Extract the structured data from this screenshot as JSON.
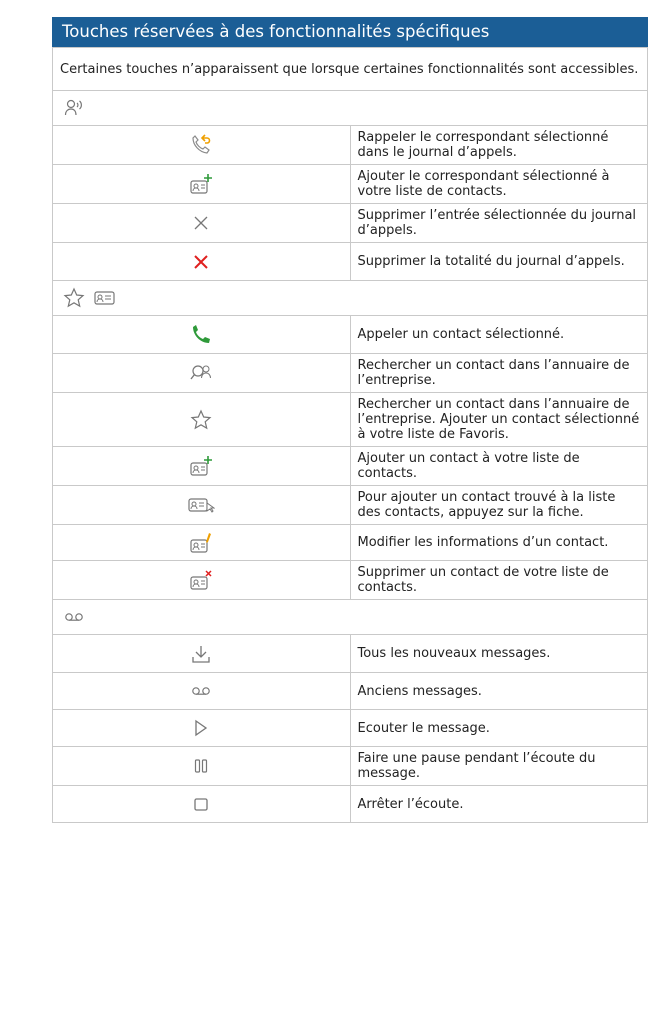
{
  "header": {
    "title": "Touches réservées à des fonctionnalités spécifiques"
  },
  "intro": "Certaines touches n’apparaissent que lorsque certaines fonctionnalités sont accessibles.",
  "sections": [
    {
      "icons": [
        "speaker-person-icon"
      ],
      "rows": [
        {
          "icon": "callback-icon",
          "text": "Rappeler le correspondant sélectionné dans le journal d’appels."
        },
        {
          "icon": "contact-add-icon",
          "text": "Ajouter le correspondant sélectionné à votre liste de contacts."
        },
        {
          "icon": "delete-icon",
          "text": "Supprimer l’entrée sélectionnée du journal d’appels."
        },
        {
          "icon": "delete-all-icon",
          "text": "Supprimer la totalité du journal d’appels."
        }
      ]
    },
    {
      "icons": [
        "star-icon",
        "contact-card-icon"
      ],
      "rows": [
        {
          "icon": "phone-call-icon",
          "text": "Appeler un contact sélectionné."
        },
        {
          "icon": "directory-search-icon",
          "text": "Rechercher un contact dans l’annuaire de l’entreprise."
        },
        {
          "icon": "favorite-star-icon",
          "text": "Rechercher un contact dans l’annuaire de l’entreprise. Ajouter un contact sélectionné à votre liste de Favoris."
        },
        {
          "icon": "contact-add-icon",
          "text": "Ajouter un contact à votre liste de contacts."
        },
        {
          "icon": "contact-card-tap-icon",
          "text": "Pour ajouter un contact trouvé à la liste des contacts, appuyez sur la fiche."
        },
        {
          "icon": "contact-edit-icon",
          "text": "Modifier les informations d’un contact."
        },
        {
          "icon": "contact-delete-icon",
          "text": "Supprimer un contact de votre liste de contacts."
        }
      ]
    },
    {
      "icons": [
        "voicemail-icon"
      ],
      "rows": [
        {
          "icon": "new-messages-icon",
          "text": "Tous les nouveaux messages."
        },
        {
          "icon": "voicemail-icon",
          "text": "Anciens messages."
        },
        {
          "icon": "play-icon",
          "text": "Ecouter le message."
        },
        {
          "icon": "pause-icon",
          "text": "Faire une pause pendant l’écoute du message."
        },
        {
          "icon": "stop-icon",
          "text": "Arrêter l’écoute."
        }
      ]
    }
  ],
  "colors": {
    "header_bg": "#1b5e96",
    "accent_red": "#e0201f",
    "accent_green": "#2f9a3a",
    "accent_orange": "#f0a000",
    "border": "#c9c9c9"
  }
}
